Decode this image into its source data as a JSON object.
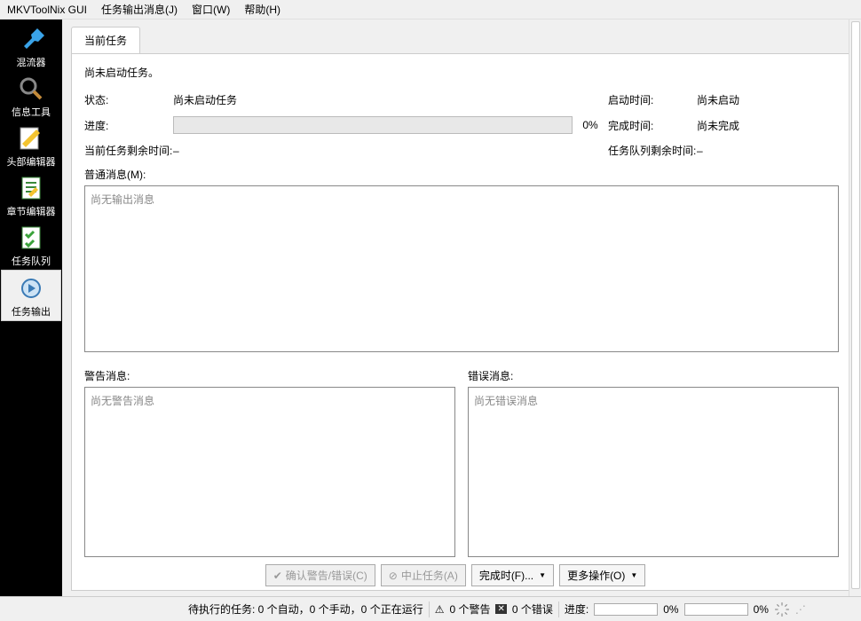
{
  "menu": {
    "app": "MKVToolNix GUI",
    "job_output": "任务输出消息(J)",
    "window": "窗口(W)",
    "help": "帮助(H)"
  },
  "sidebar": {
    "items": [
      {
        "label": "混流器"
      },
      {
        "label": "信息工具"
      },
      {
        "label": "头部编辑器"
      },
      {
        "label": "章节编辑器"
      },
      {
        "label": "任务队列"
      },
      {
        "label": "任务输出"
      }
    ]
  },
  "tab": {
    "current": "当前任务"
  },
  "body": {
    "no_task": "尚未启动任务。",
    "status_label": "状态:",
    "status_value": "尚未启动任务",
    "start_time_label": "启动时间:",
    "start_time_value": "尚未启动",
    "progress_label": "进度:",
    "progress_pct": "0%",
    "finish_time_label": "完成时间:",
    "finish_time_value": "尚未完成",
    "current_remain_label": "当前任务剩余时间:",
    "current_remain_value": "–",
    "queue_remain_label": "任务队列剩余时间:",
    "queue_remain_value": "–",
    "normal_msg_label": "普通消息(M):",
    "normal_msg_placeholder": "尚无输出消息",
    "warn_label": "警告消息:",
    "warn_placeholder": "尚无警告消息",
    "err_label": "错误消息:",
    "err_placeholder": "尚无错误消息"
  },
  "buttons": {
    "ack": "确认警告/错误(C)",
    "abort": "中止任务(A)",
    "on_finish": "完成时(F)...",
    "more": "更多操作(O)"
  },
  "status": {
    "pending": "待执行的任务: 0 个自动，0 个手动，0 个正在运行",
    "warnings": "0 个警告",
    "errors": "0 个错误",
    "progress_label": "进度:",
    "p1": "0%",
    "p2": "0%"
  }
}
